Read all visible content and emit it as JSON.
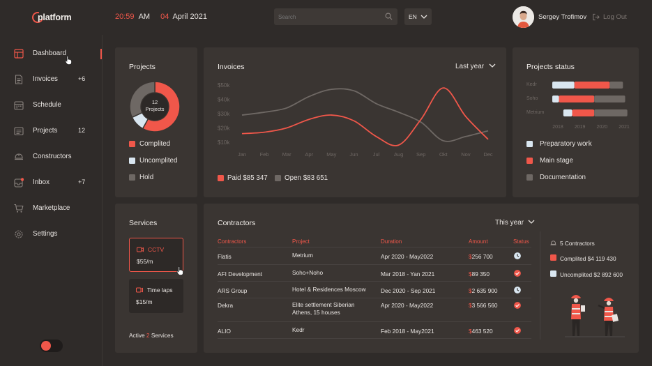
{
  "header": {
    "logo_text": "platform",
    "time": "20:59",
    "ampm": "AM",
    "day": "04",
    "month_year": "April 2021",
    "search_placeholder": "Search",
    "language": "EN",
    "user_name": "Sergey Trofimov",
    "logout_label": "Log Out"
  },
  "sidebar": {
    "items": [
      {
        "label": "Dashboard",
        "count": "",
        "icon": "dashboard-icon",
        "active": true
      },
      {
        "label": "Invoices",
        "count": "+6",
        "icon": "invoice-icon"
      },
      {
        "label": "Schedule",
        "count": "",
        "icon": "calendar-icon"
      },
      {
        "label": "Projects",
        "count": "12",
        "icon": "projects-icon"
      },
      {
        "label": "Constructors",
        "count": "",
        "icon": "helmet-icon"
      },
      {
        "label": "Inbox",
        "count": "+7",
        "icon": "inbox-icon"
      },
      {
        "label": "Marketplace",
        "count": "",
        "icon": "cart-icon"
      },
      {
        "label": "Settings",
        "count": "",
        "icon": "gear-icon"
      }
    ]
  },
  "colors": {
    "accent": "#f0574a",
    "light": "#d9e6f0",
    "gray": "#6e6864"
  },
  "projects": {
    "title": "Projects",
    "center_count": "12",
    "center_label": "Projects",
    "legend": [
      {
        "label": "Complited",
        "color": "#f0574a"
      },
      {
        "label": "Uncomplited",
        "color": "#d9e6f0"
      },
      {
        "label": "Hold",
        "color": "#6e6864"
      }
    ],
    "chart_data": {
      "type": "pie",
      "labels": [
        "Complited",
        "Uncomplited",
        "Hold"
      ],
      "values": [
        58,
        10,
        32
      ]
    }
  },
  "invoices": {
    "title": "Invoices",
    "period": "Last year",
    "legend": [
      {
        "label": "Paid $85 347",
        "color": "#f0574a"
      },
      {
        "label": "Open $83 651",
        "color": "#6e6864"
      }
    ],
    "chart_data": {
      "type": "line",
      "categories": [
        "Jan",
        "Feb",
        "Mar",
        "Apr",
        "May",
        "Jun",
        "Jul",
        "Aug",
        "Sep",
        "Okt",
        "Nov",
        "Dec"
      ],
      "yticks": [
        "$50k",
        "$40k",
        "$30k",
        "$20k",
        "$10k"
      ],
      "ylim": [
        10000,
        50000
      ],
      "series": [
        {
          "name": "Paid",
          "color": "#f0574a",
          "values": [
            16000,
            17000,
            20000,
            26000,
            29000,
            25000,
            14000,
            8000,
            26000,
            48000,
            28000,
            12000
          ]
        },
        {
          "name": "Open",
          "color": "#6e6864",
          "values": [
            29000,
            31000,
            34000,
            42000,
            47000,
            46000,
            37000,
            31000,
            24000,
            11000,
            14000,
            18000
          ]
        }
      ]
    }
  },
  "projects_status": {
    "title": "Projects status",
    "legend": [
      {
        "label": "Preparatory work",
        "color": "#d9e6f0"
      },
      {
        "label": "Main stage",
        "color": "#f0574a"
      },
      {
        "label": "Documentation",
        "color": "#6e6864"
      }
    ],
    "chart_data": {
      "type": "bar",
      "orientation": "horizontal",
      "categories": [
        "Kedr",
        "Soho",
        "Metrium"
      ],
      "xticks": [
        "2018",
        "2019",
        "2020",
        "2021"
      ],
      "rows": [
        {
          "name": "Kedr",
          "start": 2018,
          "segments": [
            1.0,
            1.6,
            0.6
          ]
        },
        {
          "name": "Soho",
          "start": 2018,
          "segments": [
            0.3,
            1.6,
            1.4
          ]
        },
        {
          "name": "Metrium",
          "start": 2018.5,
          "segments": [
            0.4,
            1.0,
            1.5
          ]
        }
      ]
    }
  },
  "services": {
    "title": "Services",
    "items": [
      {
        "name": "CCTV",
        "price": "$55/m",
        "active": true
      },
      {
        "name": "Time laps",
        "price": "$15/m",
        "active": false
      }
    ],
    "active_prefix": "Active",
    "active_count": "2",
    "active_suffix": "Services"
  },
  "contractors": {
    "title": "Contractors",
    "period": "This year",
    "headers": [
      "Contractors",
      "Project",
      "Duration",
      "Amount",
      "Status"
    ],
    "rows": [
      {
        "name": "Flatis",
        "project": "Metrium",
        "project2": "",
        "duration": "Apr 2020 - May2022",
        "amount": "256 700",
        "status": "clock"
      },
      {
        "name": "AFI Development",
        "project": "Soho+Noho",
        "project2": "",
        "duration": "Mar 2018 - Yan 2021",
        "amount": "89 350",
        "status": "check"
      },
      {
        "name": "ARS Group",
        "project": "Hotel & Residences Moscow",
        "project2": "",
        "duration": "Dec 2020 - Sep 2021",
        "amount": "2 635 900",
        "status": "clock"
      },
      {
        "name": "Dekra",
        "project": "Elite settlement Siberian",
        "project2": "Athens, 15 houses",
        "duration": "Apr 2020 - May2022",
        "amount": "3 566 560",
        "status": "check"
      },
      {
        "name": "ALIO",
        "project": "Kedr",
        "project2": "",
        "duration": "Feb 2018 - May2021",
        "amount": "463 520",
        "status": "check"
      }
    ],
    "currency": "$",
    "summary_count": "5 Contractors",
    "summary_completed": "Complited  $4 119 430",
    "summary_uncompleted": "Uncomplited  $2 892 600"
  }
}
